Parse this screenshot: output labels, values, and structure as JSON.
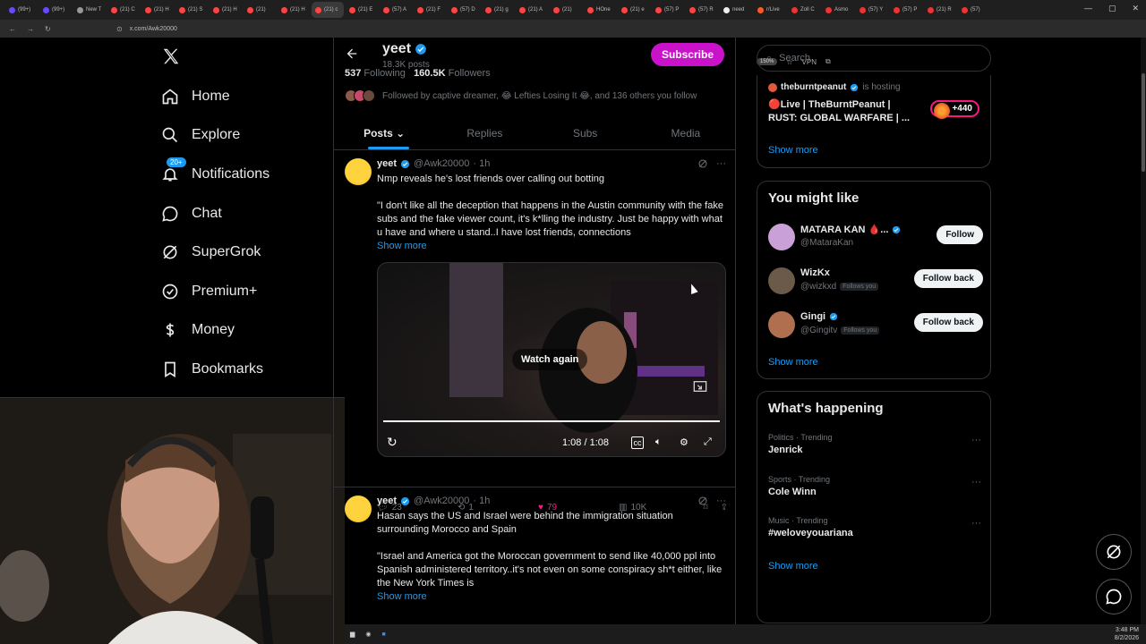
{
  "browser": {
    "tabs": [
      "(99+)",
      "(99+)",
      "New T",
      "(21) C",
      "(21) H",
      "(21) S",
      "(21) H",
      "(21) ",
      "(21) H",
      "(21) c",
      "(21) E",
      "(57) A",
      "(21) F",
      "(57) D",
      "(21) g",
      "(21) A",
      "(21) ",
      "HOne",
      "(21) e",
      "(57) P",
      "(57) R",
      "need",
      "r/Live",
      "Zoll C",
      "Asmo",
      "(57) Y",
      "(57) P",
      "(21) R",
      "(57)"
    ],
    "url": "x.com/Awk20000",
    "zoom": "150%",
    "vpn": "VPN"
  },
  "nav": {
    "items": [
      {
        "label": "Home",
        "icon": "home-icon"
      },
      {
        "label": "Explore",
        "icon": "search-icon"
      },
      {
        "label": "Notifications",
        "icon": "bell-icon",
        "badge": "20+"
      },
      {
        "label": "Chat",
        "icon": "chat-icon"
      },
      {
        "label": "SuperGrok",
        "icon": "grok-icon"
      },
      {
        "label": "Premium+",
        "icon": "verified-icon"
      },
      {
        "label": "Money",
        "icon": "dollar-icon"
      },
      {
        "label": "Bookmarks",
        "icon": "bookmark-icon"
      }
    ]
  },
  "profile": {
    "name": "yeet",
    "posts": "18.3K posts",
    "subscribe": "Subscribe",
    "following_count": "537",
    "following_label": "Following",
    "followers_count": "160.5K",
    "followers_label": "Followers",
    "followed_by": "Followed by captive dreamer, 😂 Lefties Losing It 😂, and 136 others you follow"
  },
  "tabs": [
    "Posts",
    "Replies",
    "Subs",
    "Media"
  ],
  "tweets": [
    {
      "name": "yeet",
      "handle": "@Awk20000",
      "time": "· 1h",
      "line1": "Nmp reveals he's lost friends over calling out botting",
      "body": "\"I don't like all the deception that happens in the Austin community with the fake subs and the fake viewer count, it's k*lling the industry. Just be happy with what u have and where u stand..I have lost friends, connections",
      "show_more": "Show more",
      "video": {
        "watch_again": "Watch again",
        "time": "1:08 / 1:08"
      },
      "replies": "23",
      "reposts": "1",
      "likes": "79",
      "views": "10K"
    },
    {
      "name": "yeet",
      "handle": "@Awk20000",
      "time": "· 1h",
      "line1": "Hasan says the US and Israel were behind the immigration situation surrounding Morocco and Spain",
      "body": "\"Israel and America got the Moroccan government to send like 40,000 ppl into Spanish administered territory..it's not even on some conspiracy sh*t either, like the New York Times is",
      "show_more": "Show more"
    }
  ],
  "right": {
    "search_placeholder": "Search",
    "live": {
      "host": "theburntpeanut",
      "is_hosting": "is hosting",
      "title": "🔴Live | TheBurntPeanut | RUST: GLOBAL WARFARE | ...",
      "count": "+440"
    },
    "show_more": "Show more",
    "you_might_like": {
      "title": "You might like",
      "users": [
        {
          "name": "MATARA KAN 🩸...",
          "handle": "@MataraKan",
          "btn": "Follow",
          "follows_you": ""
        },
        {
          "name": "WizKx",
          "handle": "@wizkxd",
          "btn": "Follow back",
          "follows_you": "Follows you"
        },
        {
          "name": "Gingi",
          "handle": "@Gingitv",
          "btn": "Follow back",
          "follows_you": "Follows you"
        }
      ]
    },
    "whats_happening": {
      "title": "What's happening",
      "trends": [
        {
          "category": "Politics · Trending",
          "name": "Jenrick"
        },
        {
          "category": "Sports · Trending",
          "name": "Cole Winn"
        },
        {
          "category": "Music · Trending",
          "name": "#weloveyouariana"
        }
      ]
    }
  },
  "taskbar": {
    "time": "3:48 PM",
    "date": "8/2/2026"
  },
  "colors": {
    "accent": "#1d9bf0",
    "subscribe": "#c912c9",
    "like": "#f91880"
  }
}
